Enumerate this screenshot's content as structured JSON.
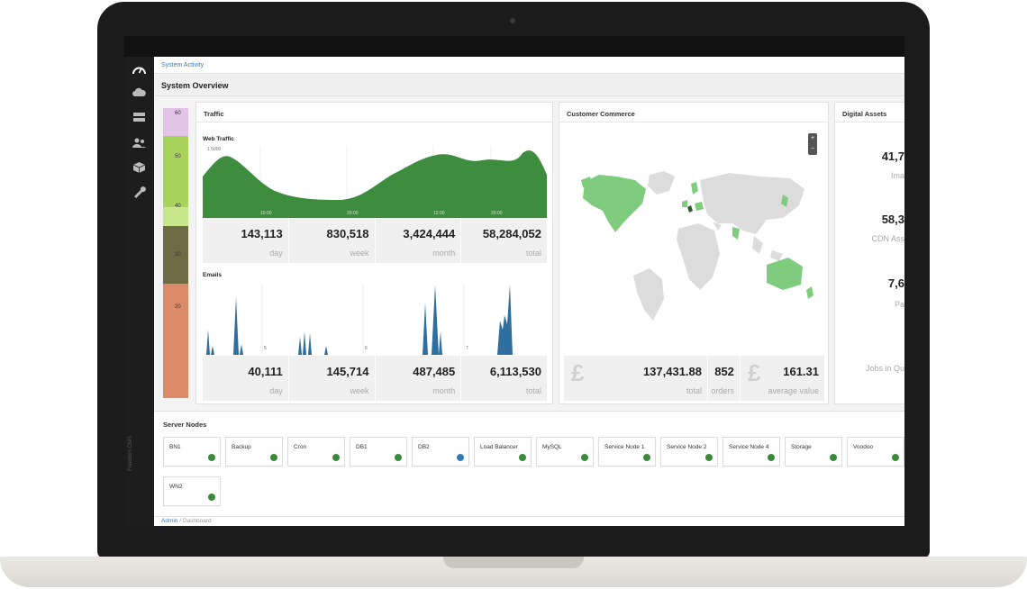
{
  "colors": {
    "traffic_green": "#3e8d3e",
    "email_blue": "#2f6f9f",
    "map_green": "#7fcc7f",
    "map_grey": "#dcdcdc",
    "status_green": "#3b8a3b",
    "status_blue": "#2f7ab9"
  },
  "breadcrumb_top": "System Activity",
  "page_title": "System Overview",
  "nav": {
    "icons": [
      "dashboard-icon",
      "cloud-icon",
      "server-icon",
      "users-icon",
      "cube-icon",
      "wrench-icon"
    ],
    "brand": "Freedom CMS"
  },
  "stack": {
    "ticks": [
      "60",
      "50",
      "40",
      "30",
      "20"
    ]
  },
  "traffic": {
    "title": "Traffic",
    "web_title": "Web Traffic",
    "web_axis_top": "1 5000",
    "web_ticks": [
      "10:00",
      "20:00",
      "12:00",
      "20:00"
    ],
    "web_stats": [
      {
        "value": "143,113",
        "label": "day"
      },
      {
        "value": "830,518",
        "label": "week"
      },
      {
        "value": "3,424,444",
        "label": "month"
      },
      {
        "value": "58,284,052",
        "label": "total"
      }
    ],
    "email_title": "Emails",
    "email_ticks": [
      "5",
      "6",
      "7"
    ],
    "email_stats": [
      {
        "value": "40,111",
        "label": "day"
      },
      {
        "value": "145,714",
        "label": "week"
      },
      {
        "value": "487,485",
        "label": "month"
      },
      {
        "value": "6,113,530",
        "label": "total"
      }
    ]
  },
  "commerce": {
    "title": "Customer Commerce",
    "zoom_in": "+",
    "zoom_out": "−",
    "currency_symbol": "£",
    "stats": [
      {
        "value": "137,431.88",
        "label": "total"
      },
      {
        "value": "852",
        "label": "orders"
      },
      {
        "value": "161.31",
        "label": "average value"
      }
    ]
  },
  "assets": {
    "title": "Digital Assets",
    "items": [
      {
        "value": "41,7",
        "label": "Ima"
      },
      {
        "value": "58,3",
        "label": "CDN Ass"
      },
      {
        "value": "7,6",
        "label": "Pa"
      }
    ],
    "jobs_label": "Jobs in Qu"
  },
  "server_nodes": {
    "title": "Server Nodes",
    "nodes": [
      {
        "name": "BN1",
        "status": "green"
      },
      {
        "name": "Backup",
        "status": "green"
      },
      {
        "name": "Cron",
        "status": "green"
      },
      {
        "name": "DB1",
        "status": "green"
      },
      {
        "name": "DB2",
        "status": "blue"
      },
      {
        "name": "Load Balancer",
        "status": "green"
      },
      {
        "name": "MySQL",
        "status": "green"
      },
      {
        "name": "Service Node 1",
        "status": "green"
      },
      {
        "name": "Service Node 2",
        "status": "green"
      },
      {
        "name": "Service Node 4",
        "status": "green"
      },
      {
        "name": "Storage",
        "status": "green"
      },
      {
        "name": "Voodoo",
        "status": "green"
      },
      {
        "name": "WN2",
        "status": "green"
      }
    ]
  },
  "breadcrumb_bottom": {
    "root": "Admin",
    "separator": "/",
    "current": "Dashboard"
  }
}
